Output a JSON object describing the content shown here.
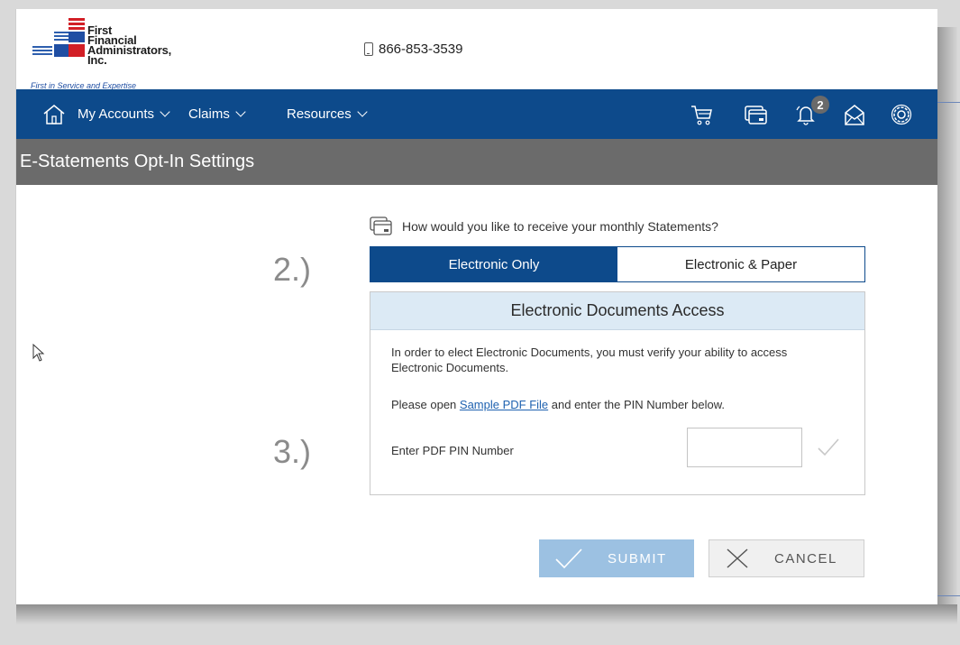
{
  "header": {
    "logo_text_lines": [
      "First",
      "Financial",
      "Administrators,",
      "Inc."
    ],
    "tagline": "First in Service and Expertise",
    "phone": "866-853-3539"
  },
  "nav": {
    "items": [
      {
        "label": "My Accounts"
      },
      {
        "label": "Claims"
      },
      {
        "label": "Resources"
      }
    ],
    "notification_count": "2",
    "icons": [
      "home-icon",
      "cart-icon",
      "card-icon",
      "bell-icon",
      "mail-icon",
      "gear-icon"
    ]
  },
  "page": {
    "title": "E-Statements Opt-In Settings",
    "question": "How would you like to receive your monthly Statements?",
    "toggle": {
      "option_1": "Electronic Only",
      "option_2": "Electronic & Paper",
      "selected": "Electronic Only"
    },
    "panel": {
      "heading": "Electronic Documents Access",
      "text1": "In order to elect Electronic Documents, you must verify your ability to access Electronic Documents.",
      "text2_prefix": "Please open ",
      "text2_link": "Sample PDF File",
      "text2_suffix": " and enter the PIN Number below.",
      "pin_label": "Enter PDF PIN Number",
      "pin_value": ""
    },
    "steps": {
      "step2": "2.)",
      "step3": "3.)"
    },
    "buttons": {
      "submit": "SUBMIT",
      "cancel": "CANCEL"
    }
  },
  "colors": {
    "nav_blue": "#0d4a8b",
    "title_gray": "#6b6b6b",
    "panel_head": "#dceaf5",
    "submit_light_blue": "#9cc1e2",
    "link_blue": "#1f62b0"
  }
}
